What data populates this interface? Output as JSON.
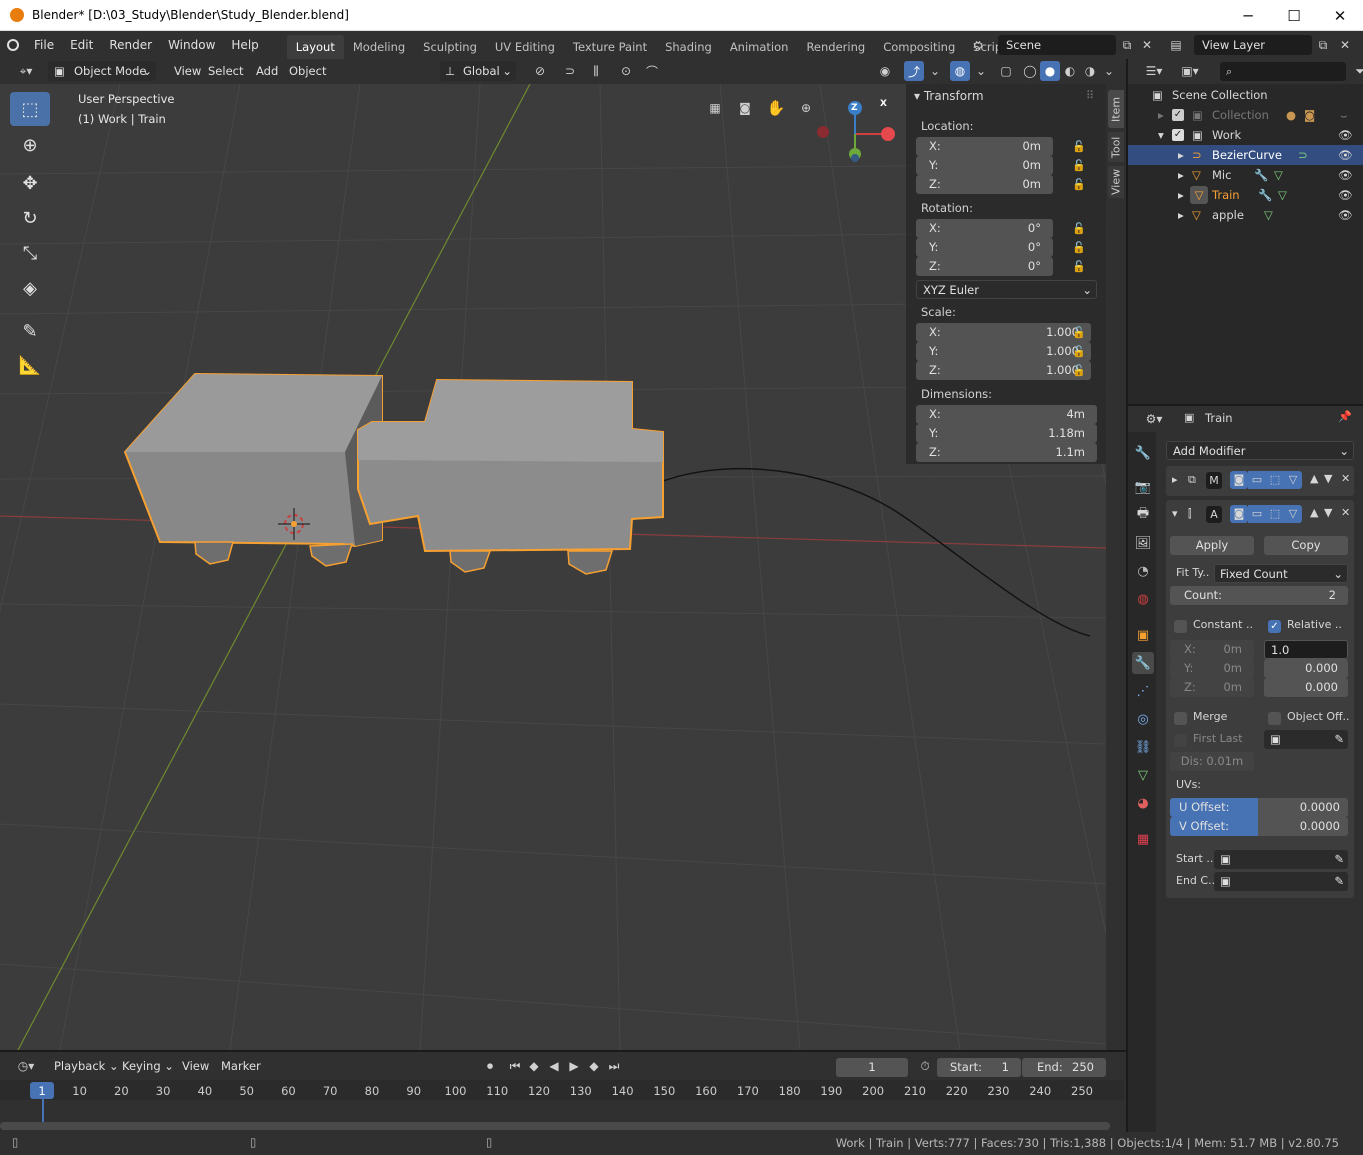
{
  "window": {
    "title": "Blender* [D:\\03_Study\\Blender\\Study_Blender.blend]",
    "minimize": "─",
    "maximize": "☐",
    "close": "✕"
  },
  "menu": [
    "File",
    "Edit",
    "Render",
    "Window",
    "Help"
  ],
  "workspaces": [
    "Layout",
    "Modeling",
    "Sculpting",
    "UV Editing",
    "Texture Paint",
    "Shading",
    "Animation",
    "Rendering",
    "Compositing",
    "Scripting"
  ],
  "active_workspace": "Layout",
  "scene": "Scene",
  "view_layer": "View Layer",
  "viewport_header": {
    "mode": "Object Mode",
    "menus": [
      "View",
      "Select",
      "Add",
      "Object"
    ],
    "orientation": "Global"
  },
  "viewport": {
    "perspective": "User Perspective",
    "collection_info": "(1) Work | Train"
  },
  "npanel": {
    "title": "Transform",
    "location_label": "Location:",
    "location": [
      {
        "k": "X:",
        "v": "0m"
      },
      {
        "k": "Y:",
        "v": "0m"
      },
      {
        "k": "Z:",
        "v": "0m"
      }
    ],
    "rotation_label": "Rotation:",
    "rotation": [
      {
        "k": "X:",
        "v": "0°"
      },
      {
        "k": "Y:",
        "v": "0°"
      },
      {
        "k": "Z:",
        "v": "0°"
      }
    ],
    "rotation_mode": "XYZ Euler",
    "scale_label": "Scale:",
    "scale": [
      {
        "k": "X:",
        "v": "1.000"
      },
      {
        "k": "Y:",
        "v": "1.000"
      },
      {
        "k": "Z:",
        "v": "1.000"
      }
    ],
    "dimensions_label": "Dimensions:",
    "dimensions": [
      {
        "k": "X:",
        "v": "4m"
      },
      {
        "k": "Y:",
        "v": "1.18m"
      },
      {
        "k": "Z:",
        "v": "1.1m"
      }
    ],
    "tabs": [
      "Item",
      "Tool",
      "View"
    ]
  },
  "outliner": {
    "rows": [
      {
        "label": "Scene Collection"
      },
      {
        "label": "Collection"
      },
      {
        "label": "Work"
      },
      {
        "label": "BezierCurve"
      },
      {
        "label": "Mic"
      },
      {
        "label": "Train"
      },
      {
        "label": "apple"
      }
    ]
  },
  "properties": {
    "object_name": "Train",
    "add_modifier": "Add Modifier",
    "mod1_name": "M",
    "mod2_name": "A",
    "apply": "Apply",
    "copy": "Copy",
    "fit_type_label": "Fit Ty..",
    "fit_type": "Fixed Count",
    "count_label": "Count:",
    "count": "2",
    "constant_label": "Constant ..",
    "relative_label": "Relative ..",
    "const_x": "X:",
    "const_xv": "0m",
    "const_y": "Y:",
    "const_yv": "0m",
    "const_z": "Z:",
    "const_zv": "0m",
    "rel_x": "1.0",
    "rel_y": "0.000",
    "rel_z": "0.000",
    "merge_label": "Merge",
    "object_offset_label": "Object Off..",
    "first_last_label": "First Last",
    "distance": "Dis: 0.01m",
    "uvs_label": "UVs:",
    "u_offset_label": "U Offset:",
    "u_offset": "0.0000",
    "v_offset_label": "V Offset:",
    "v_offset": "0.0000",
    "start_cap": "Start ..",
    "end_cap": "End C.."
  },
  "timeline": {
    "menus": [
      "Playback",
      "Keying",
      "View",
      "Marker"
    ],
    "current_frame": "1",
    "start_label": "Start:",
    "start": "1",
    "end_label": "End:",
    "end": "250",
    "ticks": [
      "1",
      "10",
      "20",
      "30",
      "40",
      "50",
      "60",
      "70",
      "80",
      "90",
      "100",
      "110",
      "120",
      "130",
      "140",
      "150",
      "160",
      "170",
      "180",
      "190",
      "200",
      "210",
      "220",
      "230",
      "240",
      "250"
    ]
  },
  "status": "Work | Train | Verts:777 | Faces:730 | Tris:1,388 | Objects:1/4 | Mem: 51.7 MB | v2.80.75",
  "colors": {
    "accent": "#4772b3",
    "selection": "#f7a032",
    "background": "#303030"
  }
}
